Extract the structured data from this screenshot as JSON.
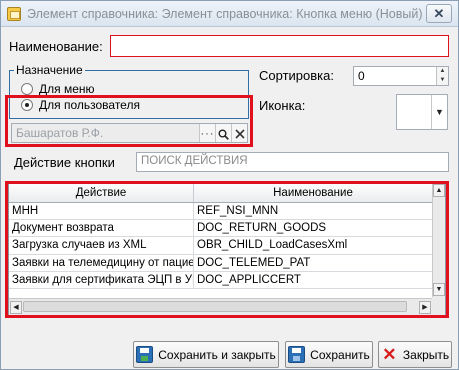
{
  "window": {
    "title": "Элемент справочника: Элемент справочника: Кнопка меню (Новый)",
    "close_glyph": "✕"
  },
  "form": {
    "name_label": "Наименование:",
    "name_value": "",
    "purpose_group": {
      "legend": "Назначение",
      "options": [
        {
          "label": "Для меню",
          "checked": false
        },
        {
          "label": "Для пользователя",
          "checked": true
        }
      ]
    },
    "user_field_placeholder": "Башаратов Р.Ф.",
    "user_field_buttons": {
      "browse": "···",
      "search": "🔍",
      "clear": "✕"
    },
    "sort_label": "Сортировка:",
    "sort_value": "0",
    "icon_label": "Иконка:",
    "action_label": "Действие кнопки",
    "action_search_placeholder": "ПОИСК ДЕЙСТВИЯ"
  },
  "table": {
    "columns": [
      "Действие",
      "Наименование"
    ],
    "rows": [
      {
        "action": "МНН",
        "name": "REF_NSI_MNN"
      },
      {
        "action": "Документ возврата",
        "name": "DOC_RETURN_GOODS"
      },
      {
        "action": "Загрузка случаев из XML",
        "name": "OBR_CHILD_LoadCasesXml"
      },
      {
        "action": "Заявки на телемедицину от пациен",
        "name": "DOC_TELEMED_PAT"
      },
      {
        "action": "Заявки для сертификата ЭЦП в УЦ",
        "name": "DOC_APPLICCERT"
      }
    ]
  },
  "buttons": {
    "save_close": "Сохранить и закрыть",
    "save": "Сохранить",
    "close": "Закрыть"
  },
  "colors": {
    "highlight": "#e0101c",
    "group_border": "#2f6fa6"
  }
}
